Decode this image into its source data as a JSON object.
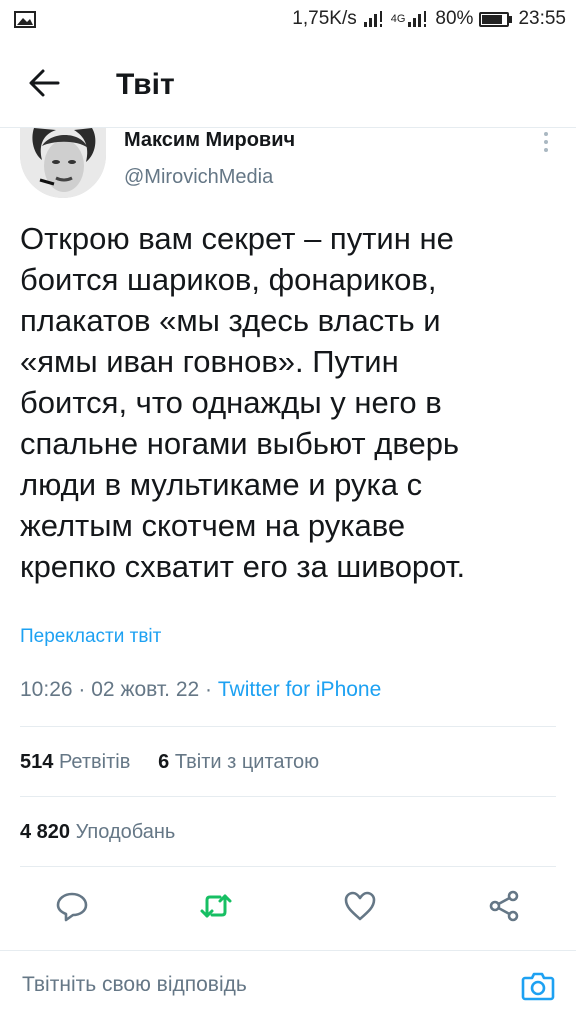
{
  "status_bar": {
    "speed": "1,75K/s",
    "network_type": "4G",
    "battery_percent": "80%",
    "battery_level": 0.8,
    "time": "23:55"
  },
  "header": {
    "title": "Твіт"
  },
  "tweet": {
    "author_name": "Максим Мирович",
    "author_handle": "@MirovichMedia",
    "text": "Открою вам секрет – путин не\nбоится шариков, фонариков,\nплакатов «мы здесь власть и\n«ямы иван говнов». Путин\nбоится, что однажды у него в\nспальне ногами выбьют дверь\nлюди в мультикаме и рука с\nжелтым скотчем на рукаве\nкрепко схватит его за шиворот.",
    "translate_label": "Перекласти твіт",
    "time": "10:26",
    "date": "02 жовт. 22",
    "separator": "·",
    "source": "Twitter for iPhone"
  },
  "stats": {
    "retweets_count": "514",
    "retweets_label": "Ретвітів",
    "quotes_count": "6",
    "quotes_label": "Твіти з цитатою",
    "likes_count": "4 820",
    "likes_label": "Уподобань"
  },
  "reply": {
    "placeholder": "Твітніть свою відповідь"
  },
  "colors": {
    "accent": "#1da1f2",
    "retweet": "#17bf63",
    "secondary_text": "#657786",
    "divider": "#e6ecf0"
  },
  "icons": {
    "image": "image-icon",
    "signal": "signal-icon",
    "battery": "battery-icon",
    "back": "arrow-left-icon",
    "more": "more-vertical-icon",
    "reply": "comment-icon",
    "retweet": "retweet-icon",
    "like": "heart-icon",
    "share": "share-icon",
    "camera": "camera-icon"
  }
}
